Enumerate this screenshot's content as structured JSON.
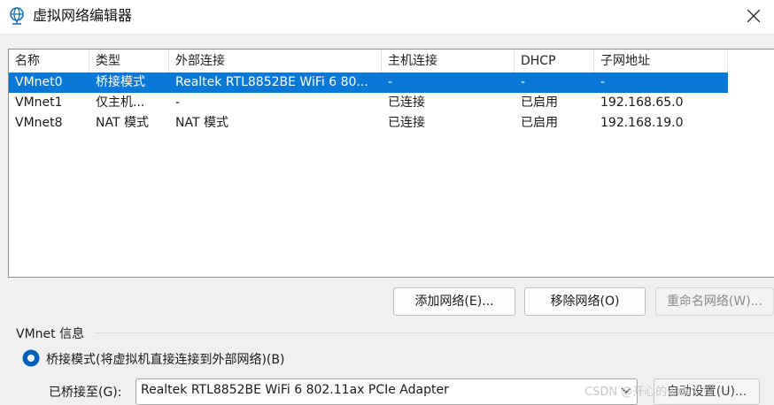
{
  "window": {
    "title": "虚拟网络编辑器",
    "icon": "network-globe-icon"
  },
  "table": {
    "columns": [
      "名称",
      "类型",
      "外部连接",
      "主机连接",
      "DHCP",
      "子网地址"
    ],
    "rows": [
      [
        "VMnet0",
        "桥接模式",
        "Realtek RTL8852BE WiFi 6 80...",
        "-",
        "-",
        "-"
      ],
      [
        "VMnet1",
        "仅主机...",
        "-",
        "已连接",
        "已启用",
        "192.168.65.0"
      ],
      [
        "VMnet8",
        "NAT 模式",
        "NAT 模式",
        "已连接",
        "已启用",
        "192.168.19.0"
      ]
    ],
    "selected_row": 0
  },
  "buttons": {
    "add": "添加网络(E)...",
    "remove": "移除网络(O)",
    "rename": "重命名网络(W)..."
  },
  "vmnet_info": {
    "label": "VMnet 信息",
    "bridge_radio": "桥接模式(将虚拟机直接连接到外部网络)(B)",
    "bridged_to_label": "已桥接至(G):",
    "bridged_to_value": "Realtek RTL8852BE WiFi 6 802.11ax PCIe Adapter",
    "auto_settings": "自动设置(U)..."
  },
  "watermark": "CSDN @开心的wxk",
  "colors": {
    "selection": "#0a78d7",
    "accent": "#005fb8"
  }
}
